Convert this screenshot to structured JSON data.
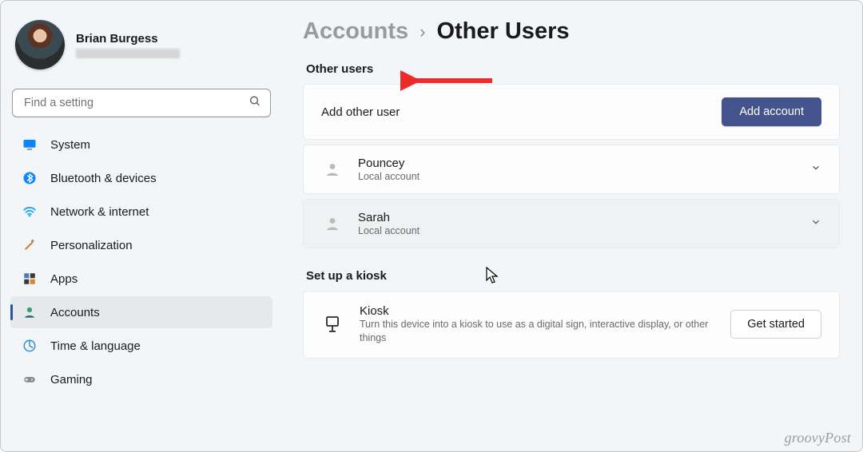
{
  "profile": {
    "name": "Brian Burgess"
  },
  "search": {
    "placeholder": "Find a setting"
  },
  "nav": {
    "items": [
      {
        "label": "System"
      },
      {
        "label": "Bluetooth & devices"
      },
      {
        "label": "Network & internet"
      },
      {
        "label": "Personalization"
      },
      {
        "label": "Apps"
      },
      {
        "label": "Accounts"
      },
      {
        "label": "Time & language"
      },
      {
        "label": "Gaming"
      }
    ]
  },
  "breadcrumb": {
    "parent": "Accounts",
    "sep": "›",
    "current": "Other Users"
  },
  "other_users": {
    "heading": "Other users",
    "add_label": "Add other user",
    "add_button": "Add account",
    "users": [
      {
        "name": "Pouncey",
        "sub": "Local account"
      },
      {
        "name": "Sarah",
        "sub": "Local account"
      }
    ]
  },
  "kiosk": {
    "heading": "Set up a kiosk",
    "title": "Kiosk",
    "desc": "Turn this device into a kiosk to use as a digital sign, interactive display, or other things",
    "button": "Get started"
  },
  "watermark": "groovyPost"
}
